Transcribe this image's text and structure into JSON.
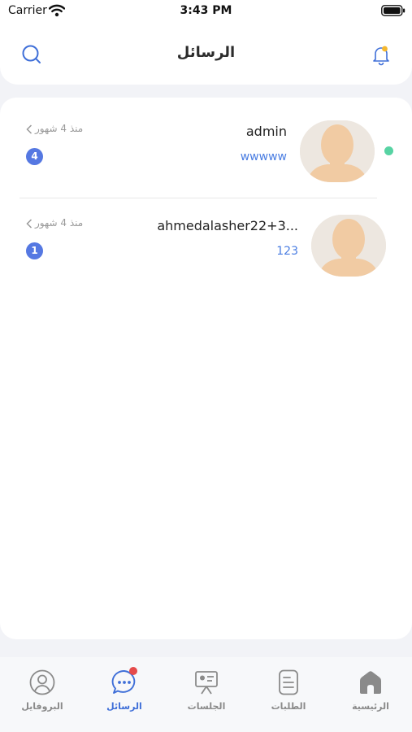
{
  "status_bar": {
    "carrier": "Carrier",
    "time": "3:43 PM"
  },
  "header": {
    "title": "الرسائل"
  },
  "conversations": [
    {
      "name": "admin",
      "preview": "wwwww",
      "time": "منذ 4 شهور",
      "unread": "4",
      "online": true
    },
    {
      "name": "ahmedalasher22+3...",
      "preview": "123",
      "time": "منذ 4 شهور",
      "unread": "1",
      "online": false
    }
  ],
  "tabbar": {
    "items": [
      {
        "label": "الرئيسية",
        "icon": "home-icon",
        "active": false
      },
      {
        "label": "الطلبات",
        "icon": "orders-icon",
        "active": false
      },
      {
        "label": "الجلسات",
        "icon": "presentation-icon",
        "active": false
      },
      {
        "label": "الرسائل",
        "icon": "chat-icon",
        "active": true,
        "has_notification": true
      },
      {
        "label": "البروفايل",
        "icon": "profile-icon",
        "active": false
      }
    ]
  },
  "colors": {
    "accent": "#3f6fd8",
    "badge": "#5578e2",
    "preview_text": "#4a7de2",
    "online": "#57d3a3",
    "notification_dot": "#e54a4a",
    "bell_dot": "#f5b82e"
  }
}
